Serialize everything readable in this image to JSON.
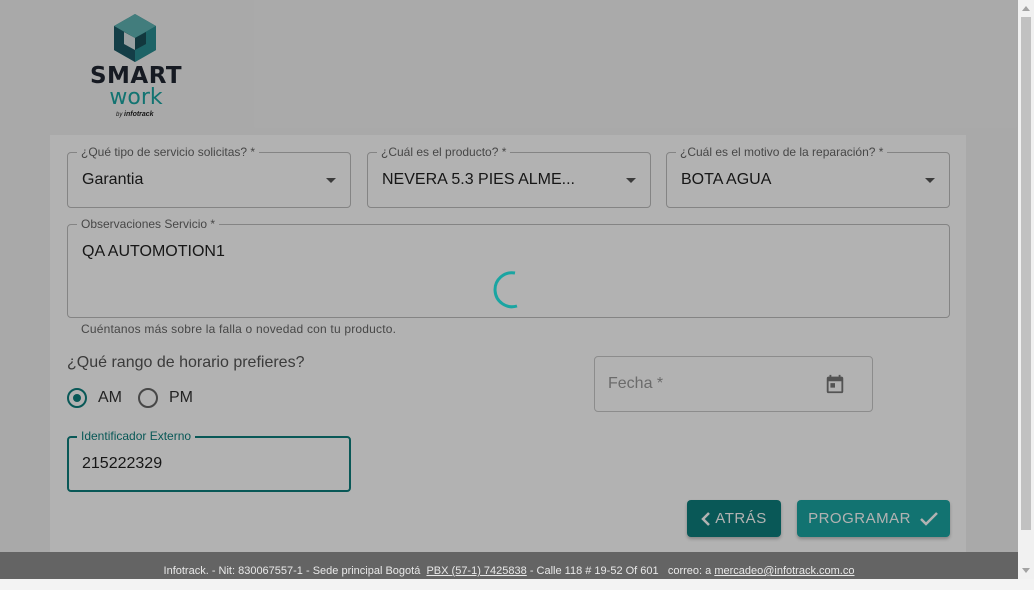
{
  "brand": {
    "smart": "SMART",
    "work": "work",
    "by": "by",
    "infotrack": "infotrack"
  },
  "form": {
    "service_type": {
      "label": "¿Qué tipo de servicio solicitas? *",
      "value": "Garantia"
    },
    "product": {
      "label": "¿Cuál es el producto? *",
      "value": "NEVERA 5.3 PIES ALME..."
    },
    "reason": {
      "label": "¿Cuál es el motivo de la reparación? *",
      "value": "BOTA AGUA"
    },
    "observations": {
      "label": "Observaciones Servicio *",
      "value": "QA AUTOMOTION1",
      "helper": "Cuéntanos más sobre la falla o novedad con tu producto."
    },
    "schedule": {
      "question": "¿Qué rango de horario prefieres?",
      "options": [
        "AM",
        "PM"
      ],
      "selected": "AM"
    },
    "date": {
      "placeholder": "Fecha *"
    },
    "external_id": {
      "label": "Identificador Externo",
      "value": "215222329"
    }
  },
  "buttons": {
    "back": "ATRÁS",
    "schedule": "PROGRAMAR"
  },
  "footer": {
    "company": "Infotrack. - Nit: 830067557-1 - Sede principal Bogotá",
    "phone": "PBX (57-1) 7425838",
    "address": "- Calle 118 # 19-52 Of 601",
    "email_prefix": "correo: a",
    "email": "mercadeo@infotrack.com.co"
  },
  "icons": {
    "calendar": "calendar-icon",
    "back": "chevron-left-icon",
    "confirm": "check-icon",
    "loading": "spinner-icon"
  },
  "colors": {
    "primary": "#0d7f7d",
    "accent": "#1aa5a2",
    "footer": "#646464"
  }
}
